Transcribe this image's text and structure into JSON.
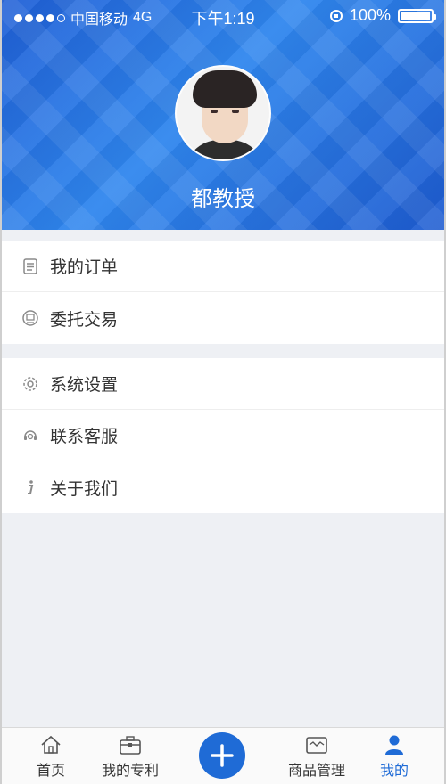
{
  "status_bar": {
    "carrier": "中国移动",
    "network": "4G",
    "time": "下午1:19",
    "battery": "100%"
  },
  "profile": {
    "name": "都教授"
  },
  "menu_groups": [
    {
      "items": [
        {
          "label": "我的订单",
          "icon": "order-list-icon"
        },
        {
          "label": "委托交易",
          "icon": "entrust-trade-icon"
        }
      ]
    },
    {
      "items": [
        {
          "label": "系统设置",
          "icon": "gear-icon"
        },
        {
          "label": "联系客服",
          "icon": "headset-icon"
        },
        {
          "label": "关于我们",
          "icon": "info-icon"
        }
      ]
    }
  ],
  "tab_bar": {
    "tabs": [
      {
        "label": "首页",
        "icon": "home-icon"
      },
      {
        "label": "我的专利",
        "icon": "briefcase-icon"
      },
      {
        "label": "商品管理",
        "icon": "goods-icon"
      },
      {
        "label": "我的",
        "icon": "person-icon",
        "active": true
      }
    ],
    "center_button_icon": "plus-icon"
  },
  "colors": {
    "accent": "#1f6bd6",
    "header_bg": "#2f86ee",
    "page_bg": "#eef0f4"
  }
}
